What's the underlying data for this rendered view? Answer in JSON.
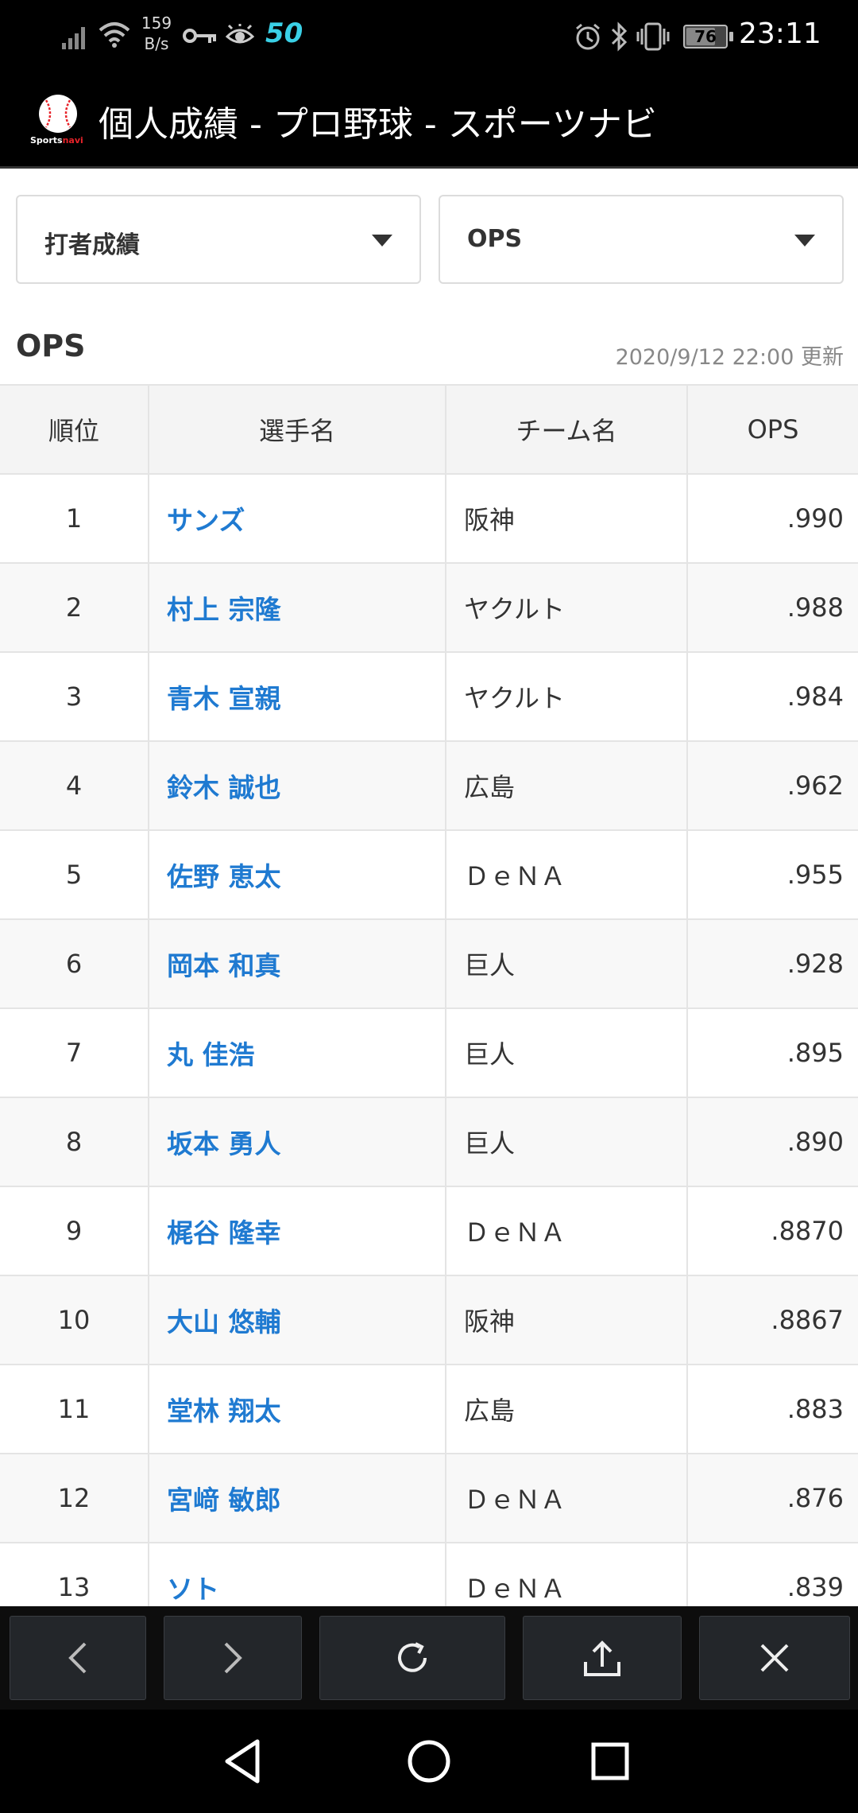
{
  "status_bar": {
    "net_speed_value": "159",
    "net_speed_unit": "B/s",
    "badge": "50",
    "battery": "76",
    "battery_level": 0.76,
    "time": "23:11"
  },
  "title_bar": {
    "logo_text_sports": "Sports",
    "logo_text_navi": "navi",
    "title": "個人成績 - プロ野球 - スポーツナビ"
  },
  "filters": {
    "category": "打者成績",
    "stat": "OPS"
  },
  "section": {
    "title": "OPS",
    "updated": "2020/9/12 22:00 更新"
  },
  "table": {
    "headers": [
      "順位",
      "選手名",
      "チーム名",
      "OPS"
    ],
    "rows": [
      {
        "rank": "1",
        "player": "サンズ",
        "team": "阪神",
        "ops": ".990"
      },
      {
        "rank": "2",
        "player": "村上 宗隆",
        "team": "ヤクルト",
        "ops": ".988"
      },
      {
        "rank": "3",
        "player": "青木 宣親",
        "team": "ヤクルト",
        "ops": ".984"
      },
      {
        "rank": "4",
        "player": "鈴木 誠也",
        "team": "広島",
        "ops": ".962"
      },
      {
        "rank": "5",
        "player": "佐野 恵太",
        "team": "ＤｅＮＡ",
        "ops": ".955"
      },
      {
        "rank": "6",
        "player": "岡本 和真",
        "team": "巨人",
        "ops": ".928"
      },
      {
        "rank": "7",
        "player": "丸 佳浩",
        "team": "巨人",
        "ops": ".895"
      },
      {
        "rank": "8",
        "player": "坂本 勇人",
        "team": "巨人",
        "ops": ".890"
      },
      {
        "rank": "9",
        "player": "梶谷 隆幸",
        "team": "ＤｅＮＡ",
        "ops": ".8870"
      },
      {
        "rank": "10",
        "player": "大山 悠輔",
        "team": "阪神",
        "ops": ".8867"
      },
      {
        "rank": "11",
        "player": "堂林 翔太",
        "team": "広島",
        "ops": ".883"
      },
      {
        "rank": "12",
        "player": "宮﨑 敏郎",
        "team": "ＤｅＮＡ",
        "ops": ".876"
      },
      {
        "rank": "13",
        "player": "ソト",
        "team": "ＤｅＮＡ",
        "ops": ".839"
      }
    ]
  },
  "colors": {
    "player_link": "#1f7ad1",
    "header_bg": "#000000",
    "badge": "#3ad0e6"
  }
}
